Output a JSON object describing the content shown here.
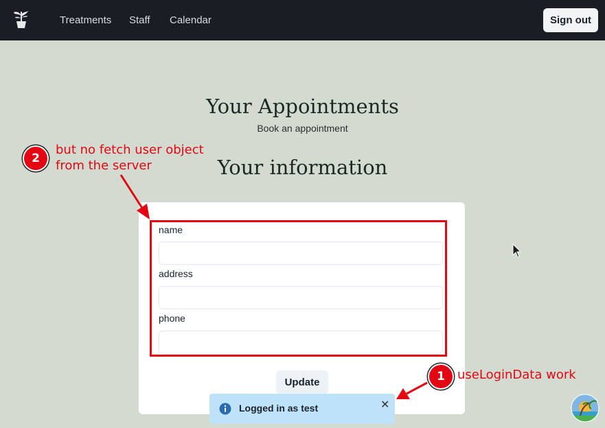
{
  "nav": {
    "items": [
      "Treatments",
      "Staff",
      "Calendar"
    ],
    "signout_label": "Sign out"
  },
  "page": {
    "title": "Your Appointments",
    "subtitle": "Book an appointment",
    "section_title": "Your information"
  },
  "form": {
    "fields": [
      {
        "label": "name",
        "value": ""
      },
      {
        "label": "address",
        "value": ""
      },
      {
        "label": "phone",
        "value": ""
      }
    ],
    "submit_label": "Update"
  },
  "toast": {
    "message": "Logged in as test",
    "icon": "info-icon",
    "close_icon": "close-icon"
  },
  "annotations": [
    {
      "number": "1",
      "text": "useLoginData work"
    },
    {
      "number": "2",
      "text_lines": [
        "but no fetch user object",
        "from the server"
      ]
    }
  ],
  "colors": {
    "navbar": "#1a1d24",
    "page_bg": "#d3dad0",
    "annotation_red": "#e30613",
    "toast_bg": "#bee3f8"
  }
}
